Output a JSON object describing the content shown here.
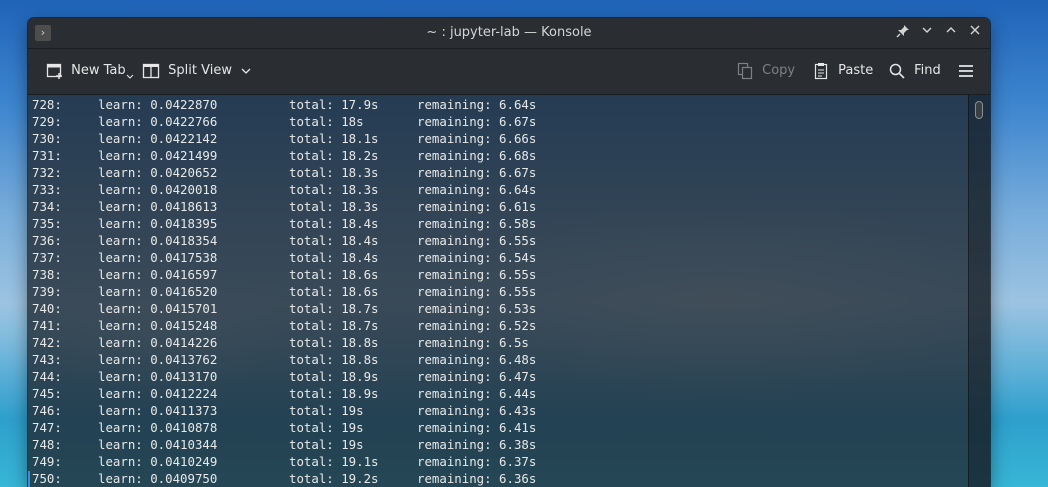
{
  "window": {
    "title": "~ : jupyter-lab — Konsole",
    "icons": {
      "app": "terminal-icon",
      "pin": "pin-icon",
      "minimize": "chevron-down-icon",
      "maximize": "chevron-up-icon",
      "close": "close-icon"
    }
  },
  "toolbar": {
    "new_tab": "New Tab",
    "split_view": "Split View",
    "copy": "Copy",
    "paste": "Paste",
    "find": "Find"
  },
  "terminal": {
    "lines": [
      {
        "iter": "728:",
        "learn": "learn: 0.0422870",
        "total": "total: 17.9s",
        "remaining": "remaining: 6.64s"
      },
      {
        "iter": "729:",
        "learn": "learn: 0.0422766",
        "total": "total: 18s",
        "remaining": "remaining: 6.67s"
      },
      {
        "iter": "730:",
        "learn": "learn: 0.0422142",
        "total": "total: 18.1s",
        "remaining": "remaining: 6.66s"
      },
      {
        "iter": "731:",
        "learn": "learn: 0.0421499",
        "total": "total: 18.2s",
        "remaining": "remaining: 6.68s"
      },
      {
        "iter": "732:",
        "learn": "learn: 0.0420652",
        "total": "total: 18.3s",
        "remaining": "remaining: 6.67s"
      },
      {
        "iter": "733:",
        "learn": "learn: 0.0420018",
        "total": "total: 18.3s",
        "remaining": "remaining: 6.64s"
      },
      {
        "iter": "734:",
        "learn": "learn: 0.0418613",
        "total": "total: 18.3s",
        "remaining": "remaining: 6.61s"
      },
      {
        "iter": "735:",
        "learn": "learn: 0.0418395",
        "total": "total: 18.4s",
        "remaining": "remaining: 6.58s"
      },
      {
        "iter": "736:",
        "learn": "learn: 0.0418354",
        "total": "total: 18.4s",
        "remaining": "remaining: 6.55s"
      },
      {
        "iter": "737:",
        "learn": "learn: 0.0417538",
        "total": "total: 18.4s",
        "remaining": "remaining: 6.54s"
      },
      {
        "iter": "738:",
        "learn": "learn: 0.0416597",
        "total": "total: 18.6s",
        "remaining": "remaining: 6.55s"
      },
      {
        "iter": "739:",
        "learn": "learn: 0.0416520",
        "total": "total: 18.6s",
        "remaining": "remaining: 6.55s"
      },
      {
        "iter": "740:",
        "learn": "learn: 0.0415701",
        "total": "total: 18.7s",
        "remaining": "remaining: 6.53s"
      },
      {
        "iter": "741:",
        "learn": "learn: 0.0415248",
        "total": "total: 18.7s",
        "remaining": "remaining: 6.52s"
      },
      {
        "iter": "742:",
        "learn": "learn: 0.0414226",
        "total": "total: 18.8s",
        "remaining": "remaining: 6.5s"
      },
      {
        "iter": "743:",
        "learn": "learn: 0.0413762",
        "total": "total: 18.8s",
        "remaining": "remaining: 6.48s"
      },
      {
        "iter": "744:",
        "learn": "learn: 0.0413170",
        "total": "total: 18.9s",
        "remaining": "remaining: 6.47s"
      },
      {
        "iter": "745:",
        "learn": "learn: 0.0412224",
        "total": "total: 18.9s",
        "remaining": "remaining: 6.44s"
      },
      {
        "iter": "746:",
        "learn": "learn: 0.0411373",
        "total": "total: 19s",
        "remaining": "remaining: 6.43s"
      },
      {
        "iter": "747:",
        "learn": "learn: 0.0410878",
        "total": "total: 19s",
        "remaining": "remaining: 6.41s"
      },
      {
        "iter": "748:",
        "learn": "learn: 0.0410344",
        "total": "total: 19s",
        "remaining": "remaining: 6.38s"
      },
      {
        "iter": "749:",
        "learn": "learn: 0.0410249",
        "total": "total: 19.1s",
        "remaining": "remaining: 6.37s"
      },
      {
        "iter": "750:",
        "learn": "learn: 0.0409750",
        "total": "total: 19.2s",
        "remaining": "remaining: 6.36s"
      }
    ]
  }
}
